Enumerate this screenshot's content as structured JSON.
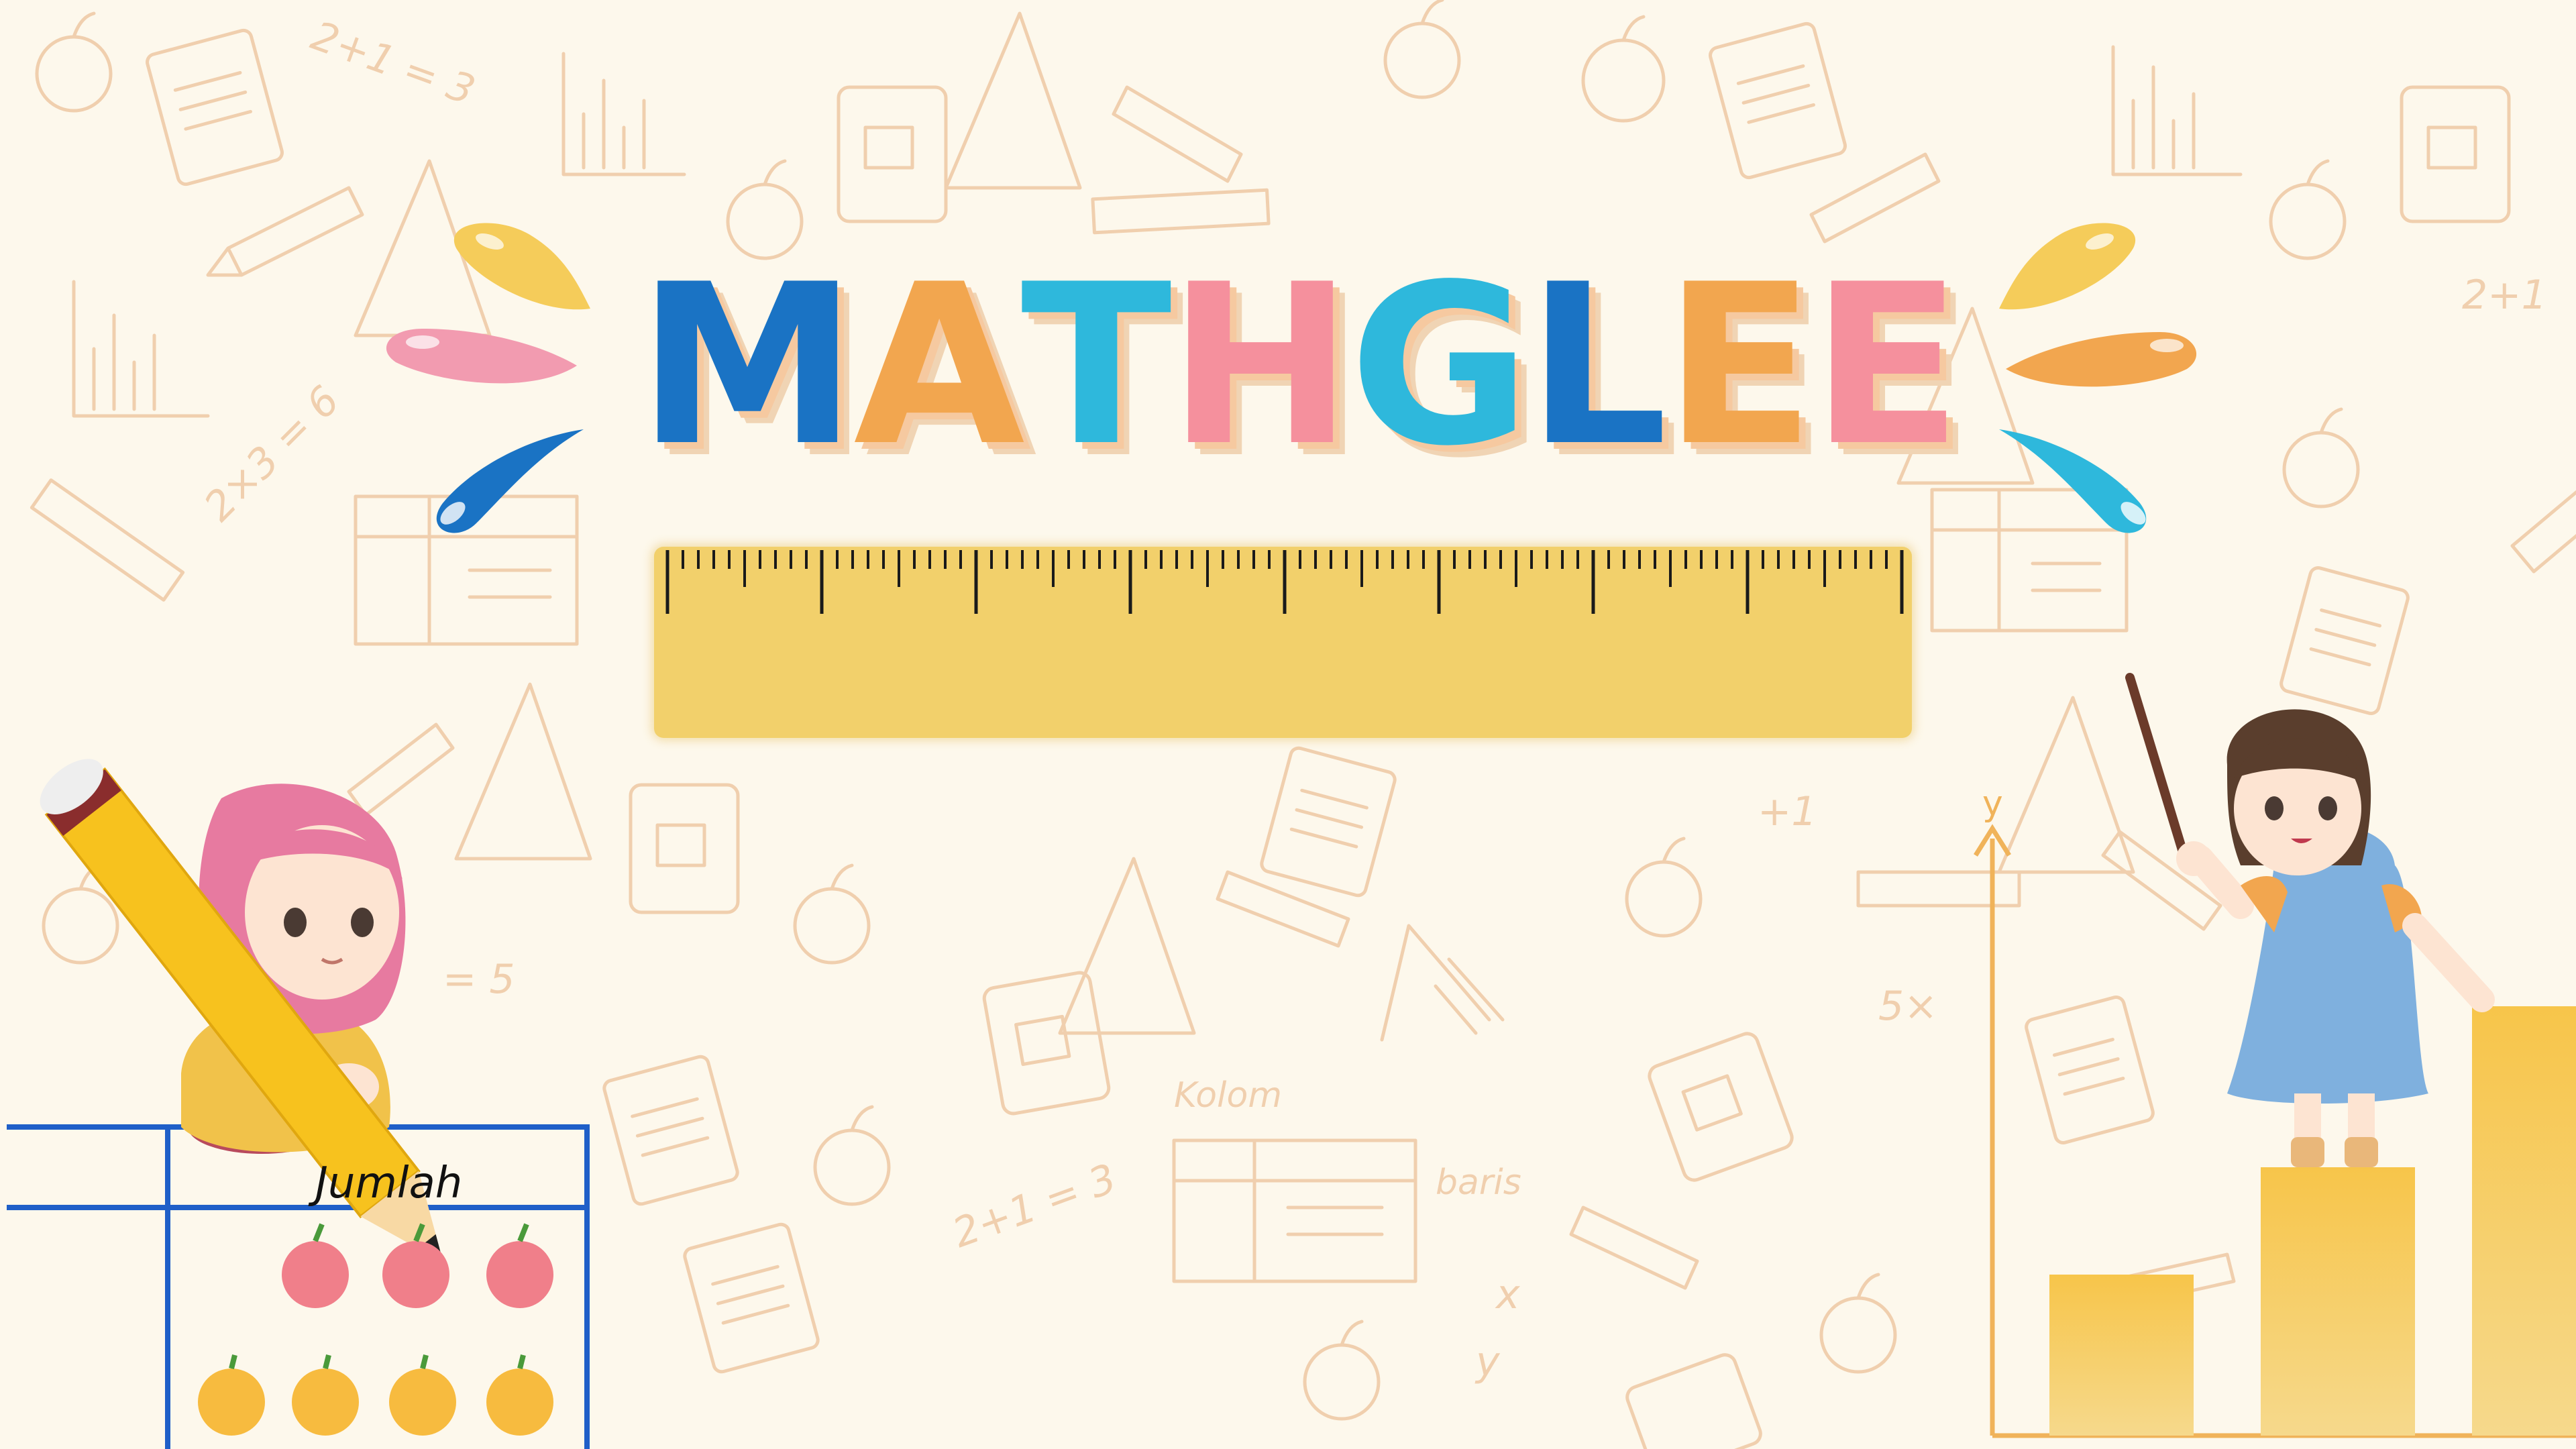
{
  "title": {
    "letters": [
      {
        "char": "M",
        "color": "#1a73c4"
      },
      {
        "char": "A",
        "color": "#f2a64f"
      },
      {
        "char": "T",
        "color": "#2eb8dc"
      },
      {
        "char": "H",
        "color": "#f5909d"
      },
      {
        "char": "G",
        "color": "#2eb8dc"
      },
      {
        "char": "L",
        "color": "#1a73c4"
      },
      {
        "char": "E",
        "color": "#f2a64f"
      },
      {
        "char": "E",
        "color": "#f5909d"
      }
    ]
  },
  "background": {
    "color": "#fdf8ec",
    "doodle_color": "#f0cfae",
    "doodle_words": [
      "2+1 = 3",
      "2×3 = 6",
      "2+1",
      "Kolom",
      "baris",
      "5×",
      "y",
      "x",
      "+1",
      "= 5"
    ]
  },
  "table_card": {
    "label": "Jumlah",
    "border_color": "#1f5fc8",
    "apples": 3,
    "oranges": 4
  },
  "bar_chart": {
    "axis_label": "y",
    "axis_color": "#f0b35a",
    "bars": [
      1,
      2,
      3
    ]
  },
  "colors": {
    "blue": "#1a73c4",
    "orange": "#f2a64f",
    "cyan": "#2eb8dc",
    "pink": "#f5909d",
    "yellow": "#f2d06b"
  },
  "icons": [
    "pencil-icon",
    "apple-icon",
    "orange-icon",
    "ruler-icon",
    "splash-icon"
  ]
}
